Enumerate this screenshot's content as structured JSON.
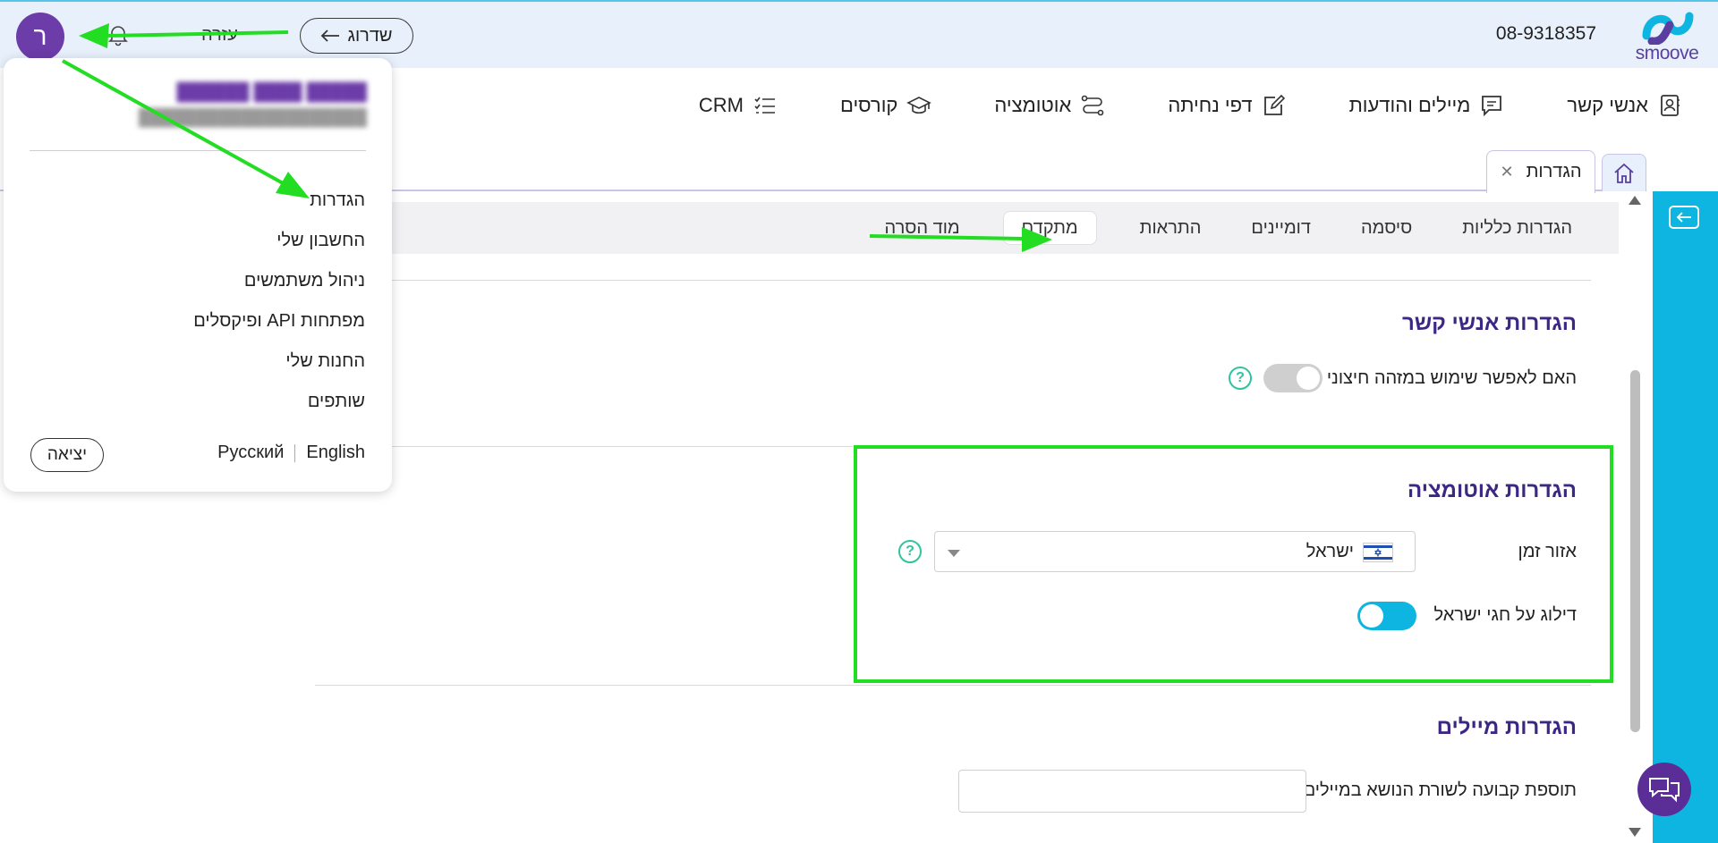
{
  "header": {
    "logo_text": "smoove",
    "phone": "08-9318357",
    "upgrade_label": "שדרוג",
    "help_label": "עזרה",
    "avatar_letter": "ר"
  },
  "nav": {
    "items": [
      {
        "label": "אנשי קשר",
        "icon": "contacts-icon"
      },
      {
        "label": "מיילים והודעות",
        "icon": "messages-icon"
      },
      {
        "label": "דפי נחיתה",
        "icon": "edit-icon"
      },
      {
        "label": "אוטומציה",
        "icon": "automation-icon"
      },
      {
        "label": "קורסים",
        "icon": "graduation-cap-icon"
      },
      {
        "label": "CRM",
        "icon": "checklist-icon"
      }
    ]
  },
  "tabs": {
    "settings_label": "הגדרות"
  },
  "subtabs": {
    "items": [
      "הגדרות כלליות",
      "סיסמה",
      "דומיינים",
      "התראות",
      "מתקדם",
      "מוד הסרה"
    ],
    "active": "מתקדם"
  },
  "sections": {
    "contacts": {
      "title": "הגדרות אנשי קשר",
      "external_id_label": "האם לאפשר שימוש במזהה חיצוני",
      "external_id_enabled": false
    },
    "automation": {
      "title": "הגדרות אוטומציה",
      "timezone_label": "אזור זמן",
      "timezone_value": "ישראל",
      "skip_holidays_label": "דילוג על חגי ישראל",
      "skip_holidays_enabled": true
    },
    "emails": {
      "title": "הגדרות מיילים",
      "subject_suffix_label": "תוספת קבועה לשורת הנושא במיילים",
      "subject_suffix_value": ""
    }
  },
  "user_menu": {
    "items": [
      "הגדרות",
      "החשבון שלי",
      "ניהול משתמשים",
      "מפתחות API ופיקסלים",
      "החנות שלי",
      "שותפים"
    ],
    "lang_english": "English",
    "lang_russian": "Русский",
    "logout_label": "יציאה"
  },
  "colors": {
    "brand_purple": "#3d2784",
    "accent_cyan": "#0fb5e1",
    "highlight_green": "#22dd22"
  }
}
